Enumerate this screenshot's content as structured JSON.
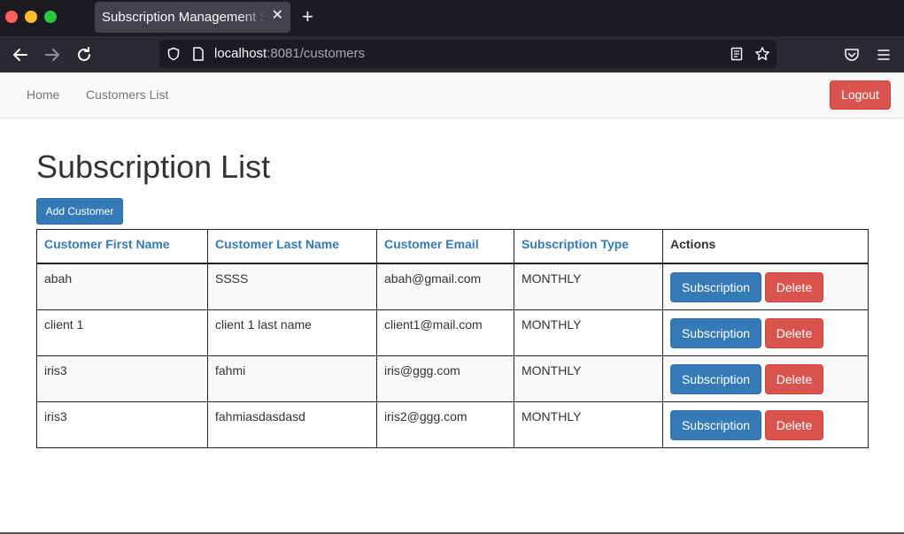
{
  "browser": {
    "tab_title": "Subscription Management System",
    "url_host": "localhost",
    "url_rest": ":8081/customers"
  },
  "navbar": {
    "home_label": "Home",
    "customers_label": "Customers List",
    "logout_label": "Logout"
  },
  "page": {
    "title": "Subscription List",
    "add_button_label": "Add Customer"
  },
  "table": {
    "headers": [
      "Customer First Name",
      "Customer Last Name",
      "Customer Email",
      "Subscription Type",
      "Actions"
    ],
    "rows": [
      {
        "first": "abah",
        "last": "SSSS",
        "email": "abah@gmail.com",
        "type": "MONTHLY"
      },
      {
        "first": "client 1",
        "last": "client 1 last name",
        "email": "client1@mail.com",
        "type": "MONTHLY"
      },
      {
        "first": "iris3",
        "last": "fahmi",
        "email": "iris@ggg.com",
        "type": "MONTHLY"
      },
      {
        "first": "iris3",
        "last": "fahmiasdasdasd",
        "email": "iris2@ggg.com",
        "type": "MONTHLY"
      }
    ],
    "subscription_button_label": "Subscription",
    "delete_button_label": "Delete"
  },
  "icons": {
    "back": "back-arrow-icon",
    "forward": "forward-arrow-icon",
    "reload": "reload-icon",
    "shield": "tracking-shield-icon",
    "page": "page-icon",
    "reader": "reader-view-icon",
    "bookmark": "bookmark-star-icon",
    "pocket": "pocket-icon",
    "menu": "hamburger-menu-icon"
  },
  "colors": {
    "primary": "#337ab7",
    "danger": "#d9534f"
  }
}
